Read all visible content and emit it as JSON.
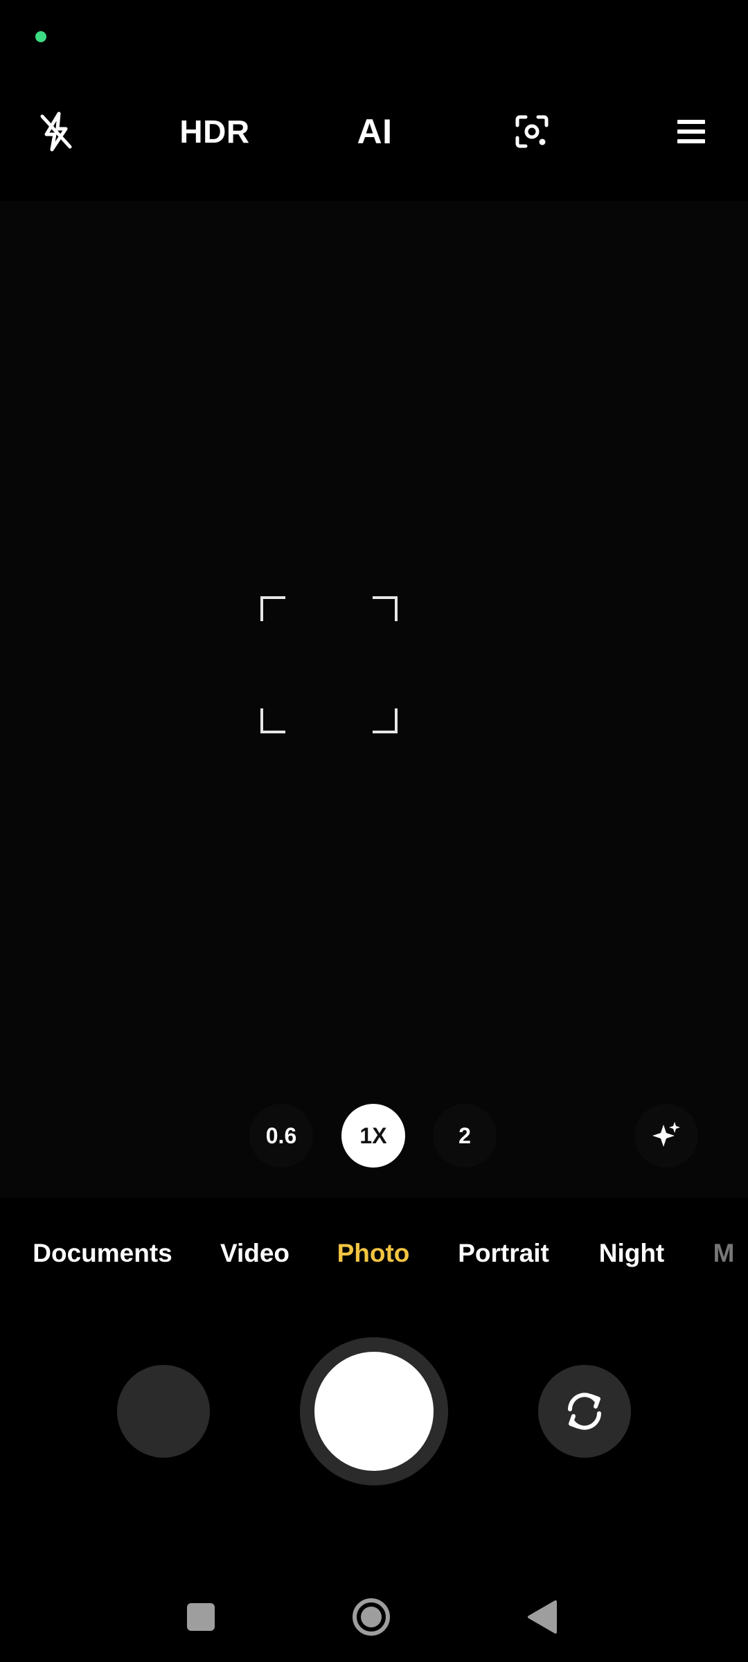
{
  "status_bar": {
    "indicator_color": "#3ddc84"
  },
  "top_toolbar": {
    "flash": {
      "icon": "flash-off-icon"
    },
    "hdr_label": "HDR",
    "ai_label": "AI",
    "lens": {
      "icon": "google-lens-icon"
    },
    "menu": {
      "icon": "menu-icon"
    }
  },
  "viewfinder": {
    "focus_frame": {
      "icon": "focus-frame-icon"
    }
  },
  "zoom": {
    "options": [
      "0.6",
      "1X",
      "2"
    ],
    "selected": "1X",
    "beauty": {
      "icon": "beauty-sparkle-icon"
    }
  },
  "modes": {
    "items": [
      "Documents",
      "Video",
      "Photo",
      "Portrait",
      "Night",
      "M"
    ],
    "selected": "Photo",
    "selected_color": "#f3c442"
  },
  "controls": {
    "gallery": {
      "icon": "gallery-thumbnail"
    },
    "shutter": {
      "icon": "shutter-button"
    },
    "switch_camera": {
      "icon": "switch-camera-icon"
    }
  },
  "nav_bar": {
    "recents": {
      "icon": "recents-square-icon"
    },
    "home": {
      "icon": "home-circle-icon"
    },
    "back": {
      "icon": "back-triangle-icon"
    }
  }
}
